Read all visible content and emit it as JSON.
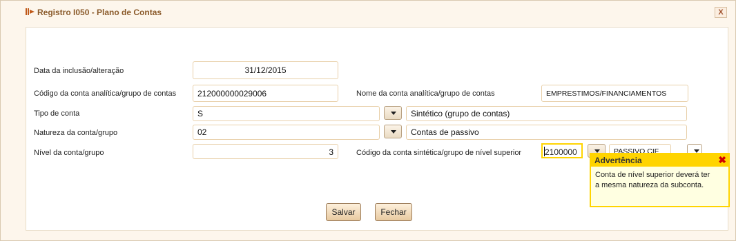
{
  "window": {
    "title": "Registro I050 - Plano de Contas",
    "close_label": "X"
  },
  "form": {
    "data_inclusao": {
      "label": "Data da inclusão/alteração",
      "value": "31/12/2015"
    },
    "codigo_conta": {
      "label": "Código da conta analítica/grupo de contas",
      "value": "212000000029006"
    },
    "nome_conta": {
      "label": "Nome da conta analítica/grupo de contas",
      "value": "EMPRESTIMOS/FINANCIAMENTOS"
    },
    "tipo_conta": {
      "label": "Tipo de conta",
      "code": "S",
      "description": "Sintético (grupo de contas)"
    },
    "natureza": {
      "label": "Natureza da conta/grupo",
      "code": "02",
      "description": "Contas de passivo"
    },
    "nivel": {
      "label": "Nível da conta/grupo",
      "value": "3"
    },
    "conta_superior": {
      "label": "Código da conta sintética/grupo de nível superior",
      "value": "2100000",
      "description": "PASSIVO CIF"
    }
  },
  "warning": {
    "title": "Advertência",
    "close_glyph": "✖",
    "message_line1": "Conta de nível superior deverá ter",
    "message_line2": "a mesma natureza da subconta."
  },
  "buttons": {
    "save": "Salvar",
    "close": "Fechar"
  },
  "colors": {
    "accent_yellow": "#ffd400",
    "title_brown": "#8a5a2a",
    "field_border": "#e8cfa8"
  }
}
